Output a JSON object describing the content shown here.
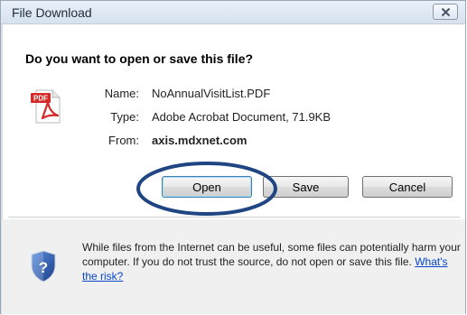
{
  "window": {
    "title": "File Download"
  },
  "dialog": {
    "question": "Do you want to open or save this file?",
    "file": {
      "name_label": "Name:",
      "name_value": "NoAnnualVisitList.PDF",
      "type_label": "Type:",
      "type_value": "Adobe Acrobat Document, 71.9KB",
      "from_label": "From:",
      "from_value": "axis.mdxnet.com",
      "icon": "pdf-file-icon",
      "icon_text": "PDF"
    },
    "buttons": {
      "open": "Open",
      "save": "Save",
      "cancel": "Cancel"
    },
    "warning": {
      "text": "While files from the Internet can be useful, some files can potentially harm your computer. If you do not trust the source, do not open or save this file.",
      "link": "What's the risk?",
      "icon": "shield-question-icon"
    }
  },
  "colors": {
    "link": "#0645cc",
    "annotation": "#1f4582",
    "accent": "#3c7fb1"
  }
}
